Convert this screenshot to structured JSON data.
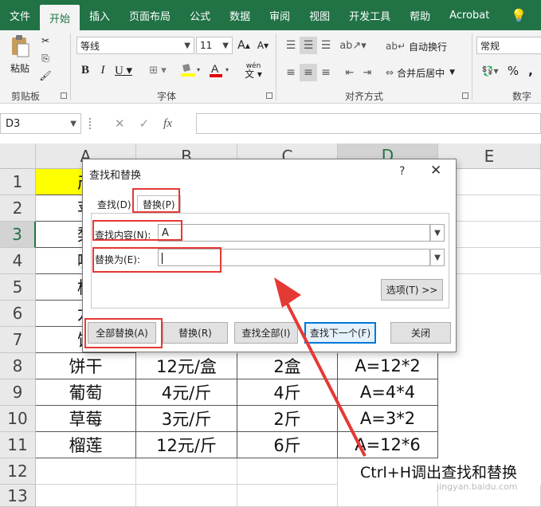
{
  "ribbon_tabs": [
    "文件",
    "开始",
    "插入",
    "页面布局",
    "公式",
    "数据",
    "审阅",
    "视图",
    "开发工具",
    "帮助",
    "Acrobat"
  ],
  "active_tab": "开始",
  "ribbon": {
    "paste_label": "粘贴",
    "clipboard_label": "剪贴板",
    "font_name": "等线",
    "font_size": "11",
    "font_label": "字体",
    "wrap_text": "自动换行",
    "merge_center": "合并后居中",
    "align_label": "对齐方式",
    "number_format": "常规",
    "number_label": "数字"
  },
  "formula_bar": {
    "name_box": "D3",
    "fx": "fx"
  },
  "grid": {
    "columns": [
      "A",
      "B",
      "C",
      "D",
      "E"
    ],
    "rows": [
      "1",
      "2",
      "3",
      "4",
      "5",
      "6",
      "7",
      "8",
      "9",
      "10",
      "11",
      "12",
      "13"
    ],
    "cells": {
      "r1a": "产",
      "r2a": "苹",
      "r3a": "梨",
      "r4a": "嗨",
      "r5a": "橘",
      "r6a": "龙",
      "r7a": "饺",
      "r8": [
        "饼干",
        "12元/盒",
        "2盒",
        "A=12*2"
      ],
      "r9": [
        "葡萄",
        "4元/斤",
        "4斤",
        "A=4*4"
      ],
      "r10": [
        "草莓",
        "3元/斤",
        "2斤",
        "A=3*2"
      ],
      "r11": [
        "榴莲",
        "12元/斤",
        "6斤",
        "A=12*6"
      ]
    }
  },
  "dialog": {
    "title": "查找和替换",
    "help": "?",
    "close": "✕",
    "tab_find": "查找(D)",
    "tab_replace": "替换(P)",
    "find_label": "查找内容(N):",
    "find_value": "A",
    "replace_label": "替换为(E):",
    "replace_value": "",
    "options_btn": "选项(T) >>",
    "replace_all_btn": "全部替换(A)",
    "replace_btn": "替换(R)",
    "find_all_btn": "查找全部(I)",
    "find_next_btn": "查找下一个(F)",
    "close_btn": "关闭"
  },
  "annotation": {
    "text": "Ctrl+H调出查找和替换",
    "watermark": "jingyan.baidu.com"
  },
  "colors": {
    "excel_green": "#217346",
    "annotation_red": "#e53935",
    "highlight_yellow": "#ffff00"
  }
}
